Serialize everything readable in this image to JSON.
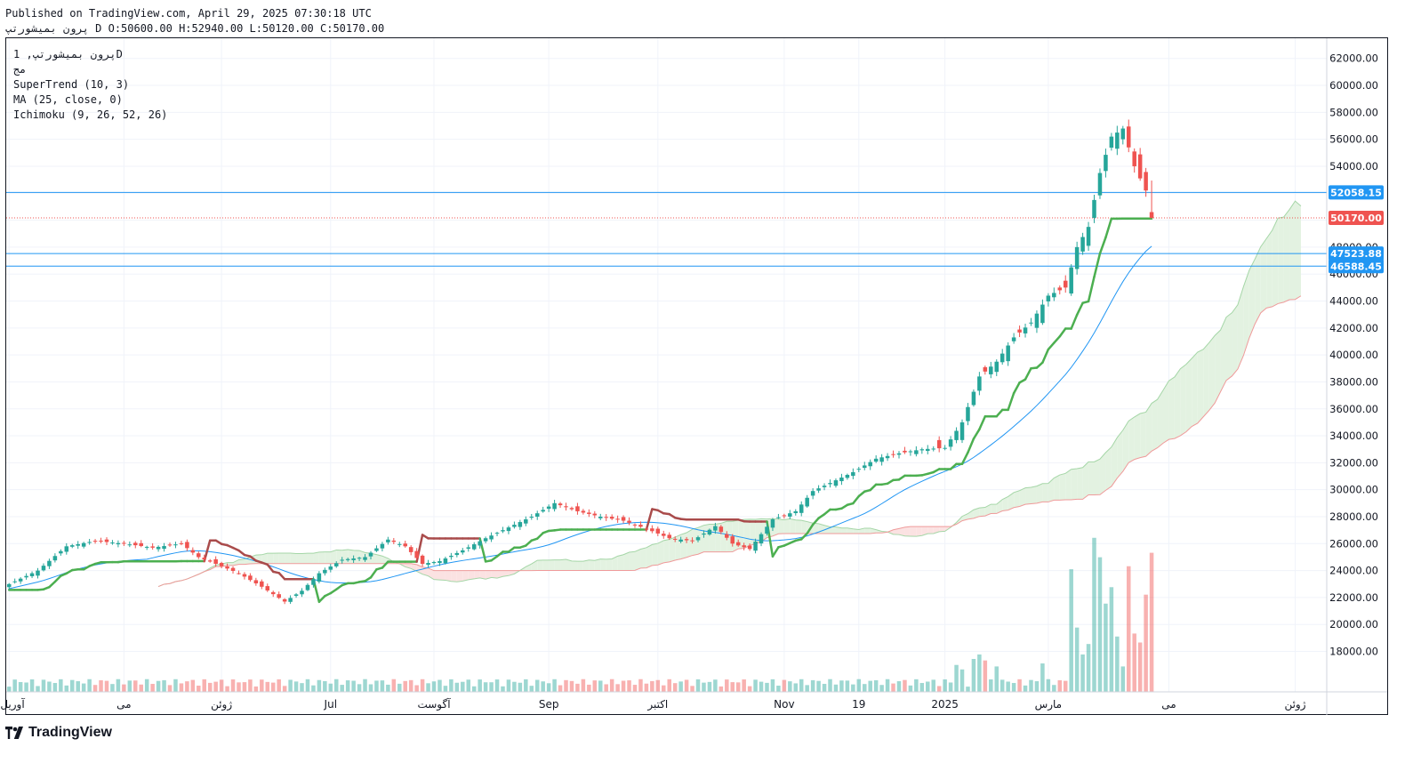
{
  "header": {
    "published": "Published on TradingView.com, April 29, 2025 07:30:18 UTC",
    "ohlc": "پرون بمیشورتپ D O:50600.00 H:52940.00 L:50120.00 C:50170.00"
  },
  "legend": {
    "symbol": "پرون بمیشورتپ, 1D",
    "exchange": "مج",
    "supertrend": "SuperTrend (10, 3)",
    "ma": "MA (25, close, 0)",
    "ichimoku": "Ichimoku (9, 26, 52, 26)"
  },
  "brand": {
    "name": "TradingView"
  },
  "colors": {
    "up": "#26a69a",
    "down": "#ef5350",
    "supertrend_up": "#4caf50",
    "supertrend_down": "#a94b4b",
    "ma": "#2196f3",
    "hline": "#2196f3",
    "last_price": "#ef5350",
    "cloud_bull": "#e3f2e1",
    "cloud_bear": "#fbe2e2"
  },
  "chart_data": {
    "type": "candlestick",
    "timeframe": "1D",
    "ylim": [
      15000,
      63500
    ],
    "y_ticks": [
      "18000.00",
      "20000.00",
      "22000.00",
      "24000.00",
      "26000.00",
      "28000.00",
      "30000.00",
      "32000.00",
      "34000.00",
      "36000.00",
      "38000.00",
      "40000.00",
      "42000.00",
      "44000.00",
      "46000.00",
      "48000.00",
      "50000.00",
      "52000.00",
      "54000.00",
      "56000.00",
      "58000.00",
      "60000.00",
      "62000.00"
    ],
    "x_ticks": [
      {
        "label": "آوریل",
        "index": 0
      },
      {
        "label": "می",
        "index": 20
      },
      {
        "label": "ژوئن",
        "index": 37
      },
      {
        "label": "Jul",
        "index": 56
      },
      {
        "label": "آگوست",
        "index": 74
      },
      {
        "label": "Sep",
        "index": 94
      },
      {
        "label": "اکتبر",
        "index": 113
      },
      {
        "label": "Nov",
        "index": 135
      },
      {
        "label": "19",
        "index": 148
      },
      {
        "label": "2025",
        "index": 163
      },
      {
        "label": "مارس",
        "index": 181
      },
      {
        "label": "می",
        "index": 202
      },
      {
        "label": "ژوئن",
        "index": 224
      }
    ],
    "price_levels": [
      {
        "label": "52058.15",
        "value": 52058.15,
        "kind": "hline"
      },
      {
        "label": "50170.00",
        "value": 50170,
        "kind": "last"
      },
      {
        "label": "47523.88",
        "value": 47523.88,
        "kind": "hline"
      },
      {
        "label": "46588.45",
        "value": 46588.45,
        "kind": "hline"
      }
    ],
    "ohlc_last": {
      "open": 50600,
      "high": 52940,
      "low": 50120,
      "close": 50170
    },
    "close_anchors": [
      [
        0,
        23000
      ],
      [
        5,
        24000
      ],
      [
        10,
        25800
      ],
      [
        15,
        26200
      ],
      [
        20,
        26000
      ],
      [
        25,
        25700
      ],
      [
        30,
        26000
      ],
      [
        33,
        25000
      ],
      [
        36,
        24500
      ],
      [
        40,
        23800
      ],
      [
        44,
        22800
      ],
      [
        48,
        21700
      ],
      [
        51,
        22500
      ],
      [
        54,
        23800
      ],
      [
        58,
        24800
      ],
      [
        62,
        25000
      ],
      [
        66,
        26300
      ],
      [
        69,
        25800
      ],
      [
        72,
        24500
      ],
      [
        75,
        24700
      ],
      [
        79,
        25500
      ],
      [
        83,
        26400
      ],
      [
        87,
        27200
      ],
      [
        91,
        28000
      ],
      [
        95,
        29000
      ],
      [
        99,
        28400
      ],
      [
        103,
        28000
      ],
      [
        107,
        27700
      ],
      [
        111,
        27100
      ],
      [
        115,
        26400
      ],
      [
        119,
        26200
      ],
      [
        123,
        27300
      ],
      [
        126,
        26000
      ],
      [
        129,
        25600
      ],
      [
        133,
        27800
      ],
      [
        137,
        28400
      ],
      [
        140,
        29900
      ],
      [
        143,
        30500
      ],
      [
        147,
        31300
      ],
      [
        151,
        32300
      ],
      [
        155,
        32700
      ],
      [
        159,
        33000
      ],
      [
        163,
        33100
      ],
      [
        166,
        35000
      ],
      [
        169,
        38400
      ],
      [
        172,
        39500
      ],
      [
        175,
        41300
      ],
      [
        178,
        42400
      ],
      [
        181,
        44400
      ],
      [
        184,
        45000
      ],
      [
        186,
        48000
      ],
      [
        188,
        49500
      ],
      [
        190,
        53500
      ],
      [
        192,
        56200
      ],
      [
        194,
        56800
      ],
      [
        196,
        54000
      ],
      [
        198,
        52200
      ],
      [
        199,
        50170
      ]
    ],
    "volume_spikes": [
      [
        165,
        1800
      ],
      [
        166,
        1500
      ],
      [
        168,
        2200
      ],
      [
        169,
        2500
      ],
      [
        170,
        2100
      ],
      [
        172,
        1700
      ],
      [
        180,
        1900
      ],
      [
        185,
        8200
      ],
      [
        186,
        4300
      ],
      [
        187,
        2500
      ],
      [
        188,
        3200
      ],
      [
        189,
        10300
      ],
      [
        190,
        9000
      ],
      [
        191,
        5900
      ],
      [
        192,
        7000
      ],
      [
        193,
        3700
      ],
      [
        194,
        1700
      ],
      [
        195,
        8400
      ],
      [
        196,
        3900
      ],
      [
        197,
        3300
      ],
      [
        198,
        6500
      ],
      [
        199,
        9300
      ],
      [
        200,
        8600
      ],
      [
        201,
        5200
      ]
    ]
  }
}
